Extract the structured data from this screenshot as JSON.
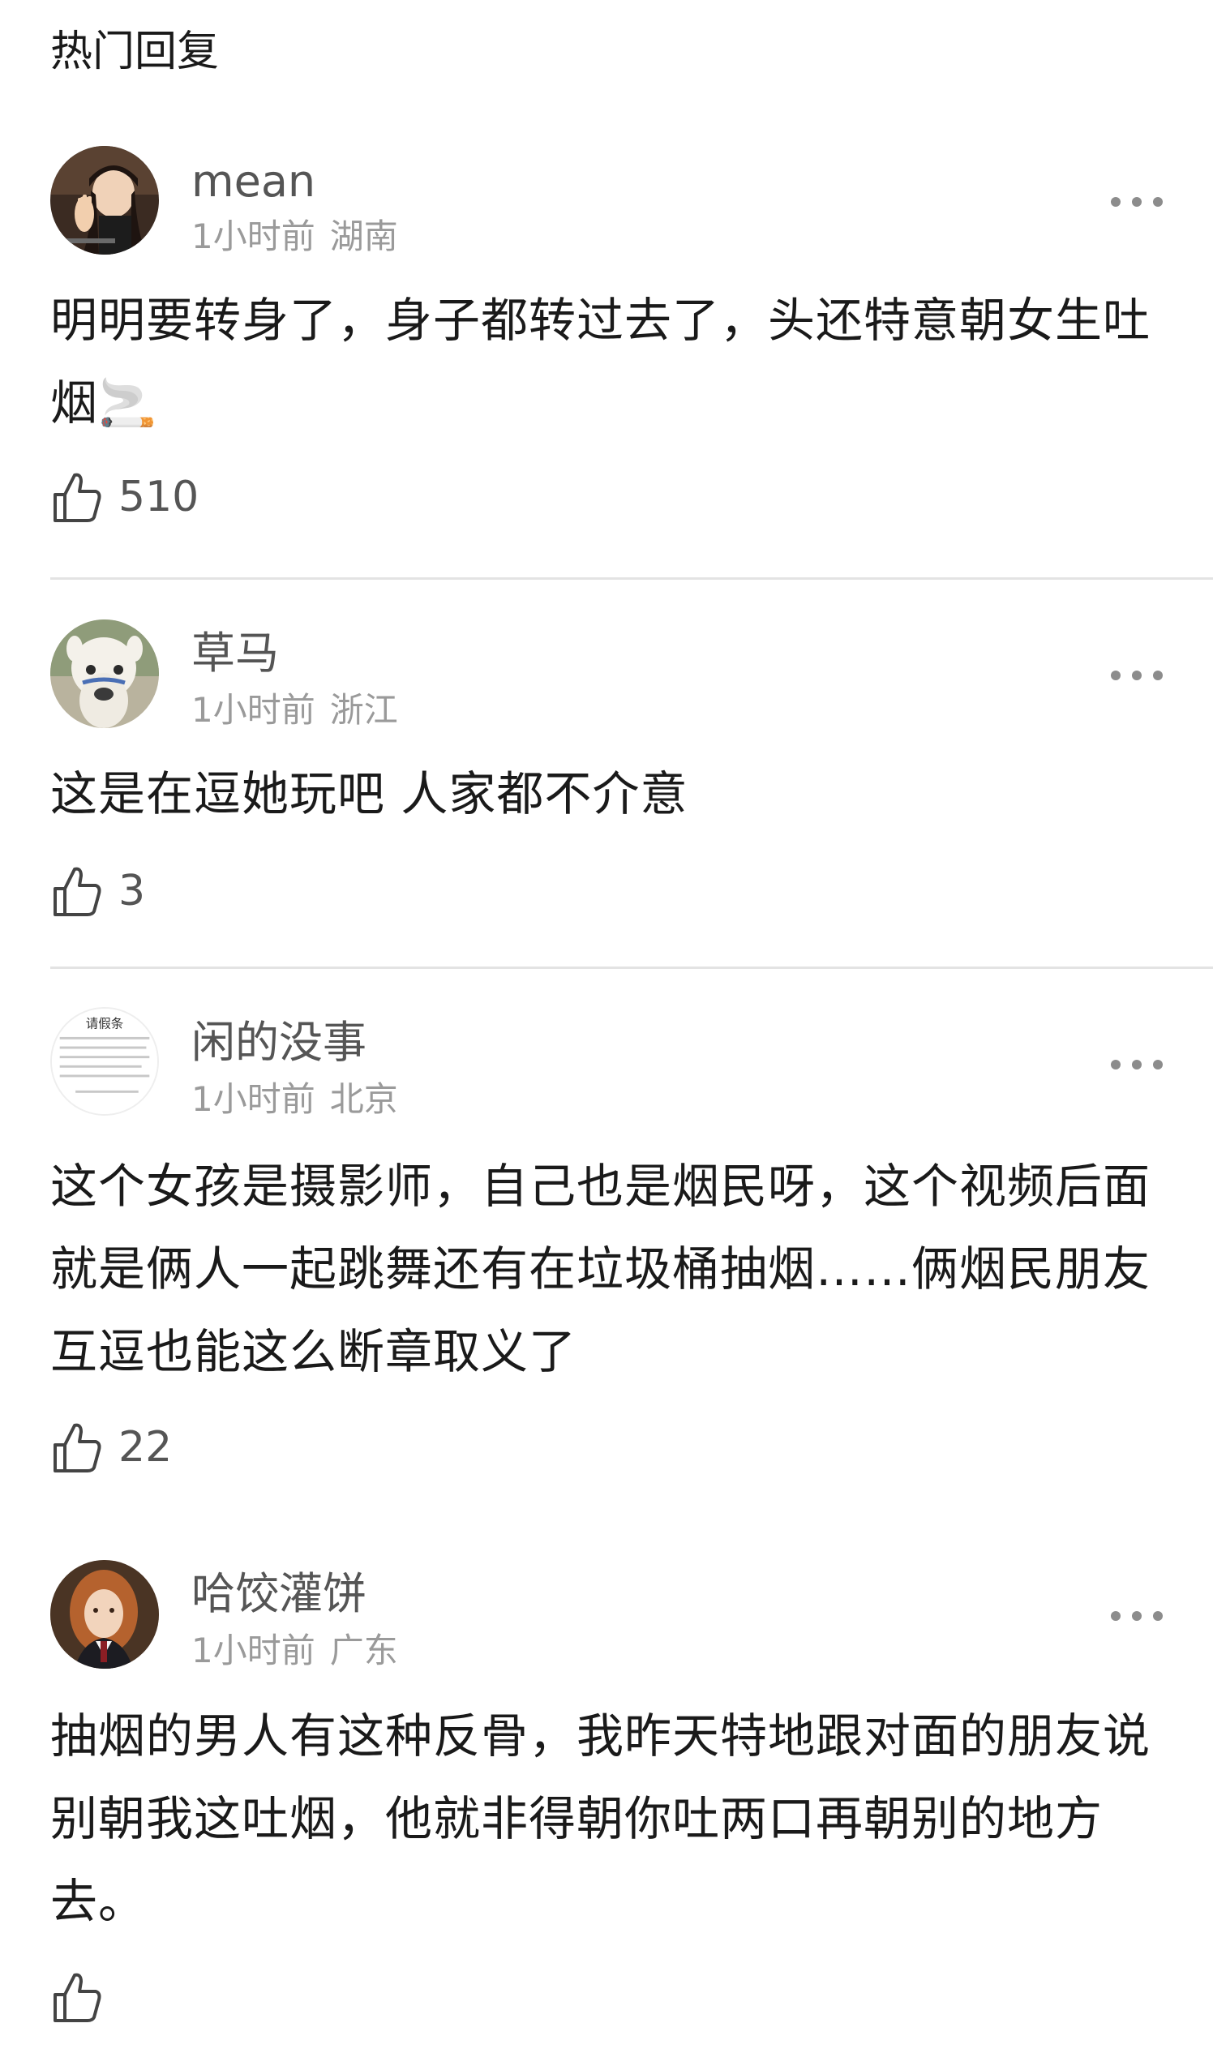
{
  "header": {
    "title": "热门回复"
  },
  "comments": [
    {
      "username": "mean",
      "time": "1小时前",
      "location": "湖南",
      "text": "明明要转身了，身子都转过去了，头还特意朝女生吐烟🚬",
      "likes": "510",
      "avatar": "avatar-woman-icon"
    },
    {
      "username": "草马",
      "time": "1小时前",
      "location": "浙江",
      "text": "这是在逗她玩吧 人家都不介意",
      "likes": "3",
      "avatar": "avatar-alpaca-icon"
    },
    {
      "username": "闲的没事",
      "time": "1小时前",
      "location": "北京",
      "text": "这个女孩是摄影师，自己也是烟民呀，这个视频后面就是俩人一起跳舞还有在垃圾桶抽烟……俩烟民朋友互逗也能这么断章取义了",
      "likes": "22",
      "avatar": "avatar-document-icon",
      "avatar_text": "请假条"
    },
    {
      "username": "哈饺灌饼",
      "time": "1小时前",
      "location": "广东",
      "text": "抽烟的男人有这种反骨，我昨天特地跟对面的朋友说别朝我这吐烟，他就非得朝你吐两口再朝别的地方去。",
      "likes": "",
      "avatar": "avatar-girl-icon"
    }
  ],
  "icons": {
    "like": "thumbs-up-icon",
    "more": "more-dots-icon"
  },
  "colors": {
    "text": "#1a1a1a",
    "username": "#555555",
    "meta": "#9a9a9a",
    "divider": "#e3e3e3"
  }
}
